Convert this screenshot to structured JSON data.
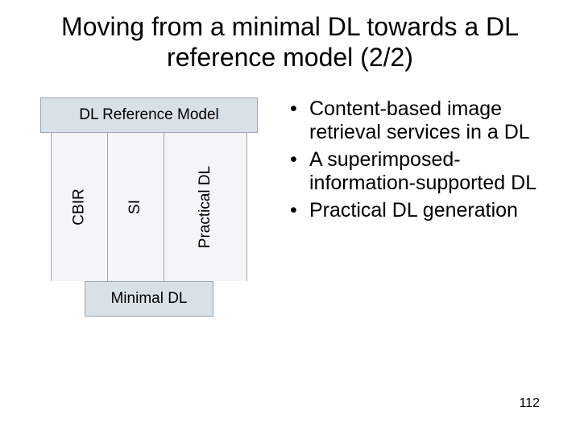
{
  "title": "Moving from a minimal DL towards a DL reference model (2/2)",
  "diagram": {
    "top": "DL Reference Model",
    "pillars": [
      "CBIR",
      "SI",
      "Practical DL"
    ],
    "bottom": "Minimal DL"
  },
  "bullets": [
    "Content-based image retrieval services in a DL",
    "A superimposed-information-supported DL",
    "Practical DL generation"
  ],
  "page_number": "112"
}
